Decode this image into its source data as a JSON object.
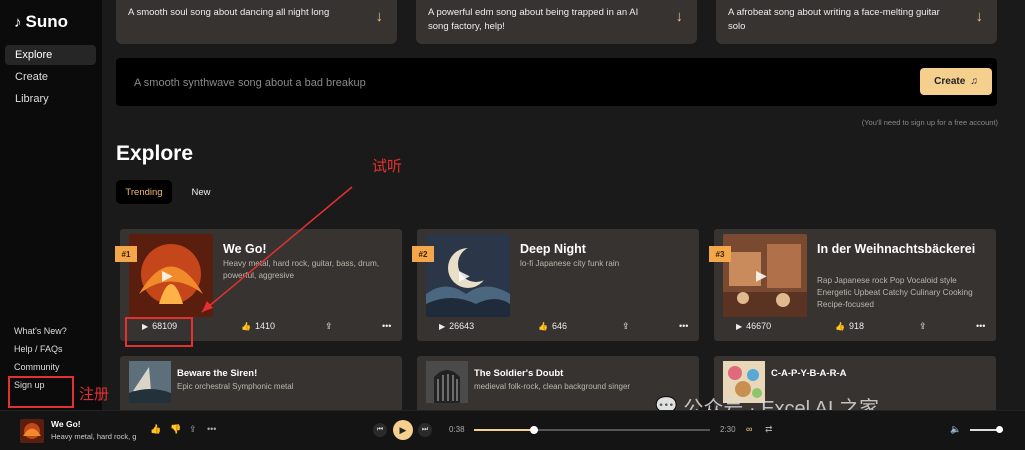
{
  "app": {
    "name": "Suno"
  },
  "sidebar": {
    "nav": [
      {
        "label": "Explore",
        "active": true
      },
      {
        "label": "Create"
      },
      {
        "label": "Library"
      }
    ],
    "bottom_links": [
      "What's New?",
      "Help / FAQs",
      "Community",
      "Sign up"
    ]
  },
  "prompts": [
    {
      "text": "A smooth soul song about dancing all night long"
    },
    {
      "text": "A powerful edm song about being trapped in an AI song factory, help!"
    },
    {
      "text": "A afrobeat song about writing a face-melting guitar solo"
    }
  ],
  "create": {
    "placeholder": "A smooth synthwave song about a bad breakup",
    "button_label": "Create",
    "note": "(You'll need to sign up for a free account)"
  },
  "explore": {
    "title": "Explore",
    "tabs": [
      {
        "label": "Trending",
        "active": true
      },
      {
        "label": "New"
      }
    ]
  },
  "trending": [
    {
      "rank": "#1",
      "title": "We Go!",
      "desc": "Heavy metal, hard rock, guitar, bass, drum, powerful, aggresive",
      "plays": "68109",
      "likes": "1410"
    },
    {
      "rank": "#2",
      "title": "Deep Night",
      "desc": "lo-fi Japanese city funk rain",
      "plays": "26643",
      "likes": "646"
    },
    {
      "rank": "#3",
      "title": "In der Weihnachtsbäckerei",
      "desc": "Rap Japanese rock Pop Vocaloid style Energetic Upbeat Catchy Culinary Cooking Recipe-focused",
      "plays": "46670",
      "likes": "918"
    }
  ],
  "more_songs": [
    {
      "title": "Beware the Siren!",
      "desc": "Epic orchestral Symphonic metal"
    },
    {
      "title": "The Soldier's Doubt",
      "desc": "medieval folk-rock, clean background singer"
    },
    {
      "title": "C-A-P-Y-B-A-R-A",
      "desc": ""
    }
  ],
  "annotations": {
    "listen": "试听",
    "signup": "注册"
  },
  "watermark": "公众号 · Excel AI 之家",
  "player": {
    "title": "We Go!",
    "desc": "Heavy metal, hard rock, g",
    "current_time": "0:38",
    "total_time": "2:30",
    "progress": 0.25
  },
  "colors": {
    "accent": "#f5cf8e",
    "rank_badge": "#f3a64a",
    "card": "#373330",
    "annotation": "#e53030"
  }
}
